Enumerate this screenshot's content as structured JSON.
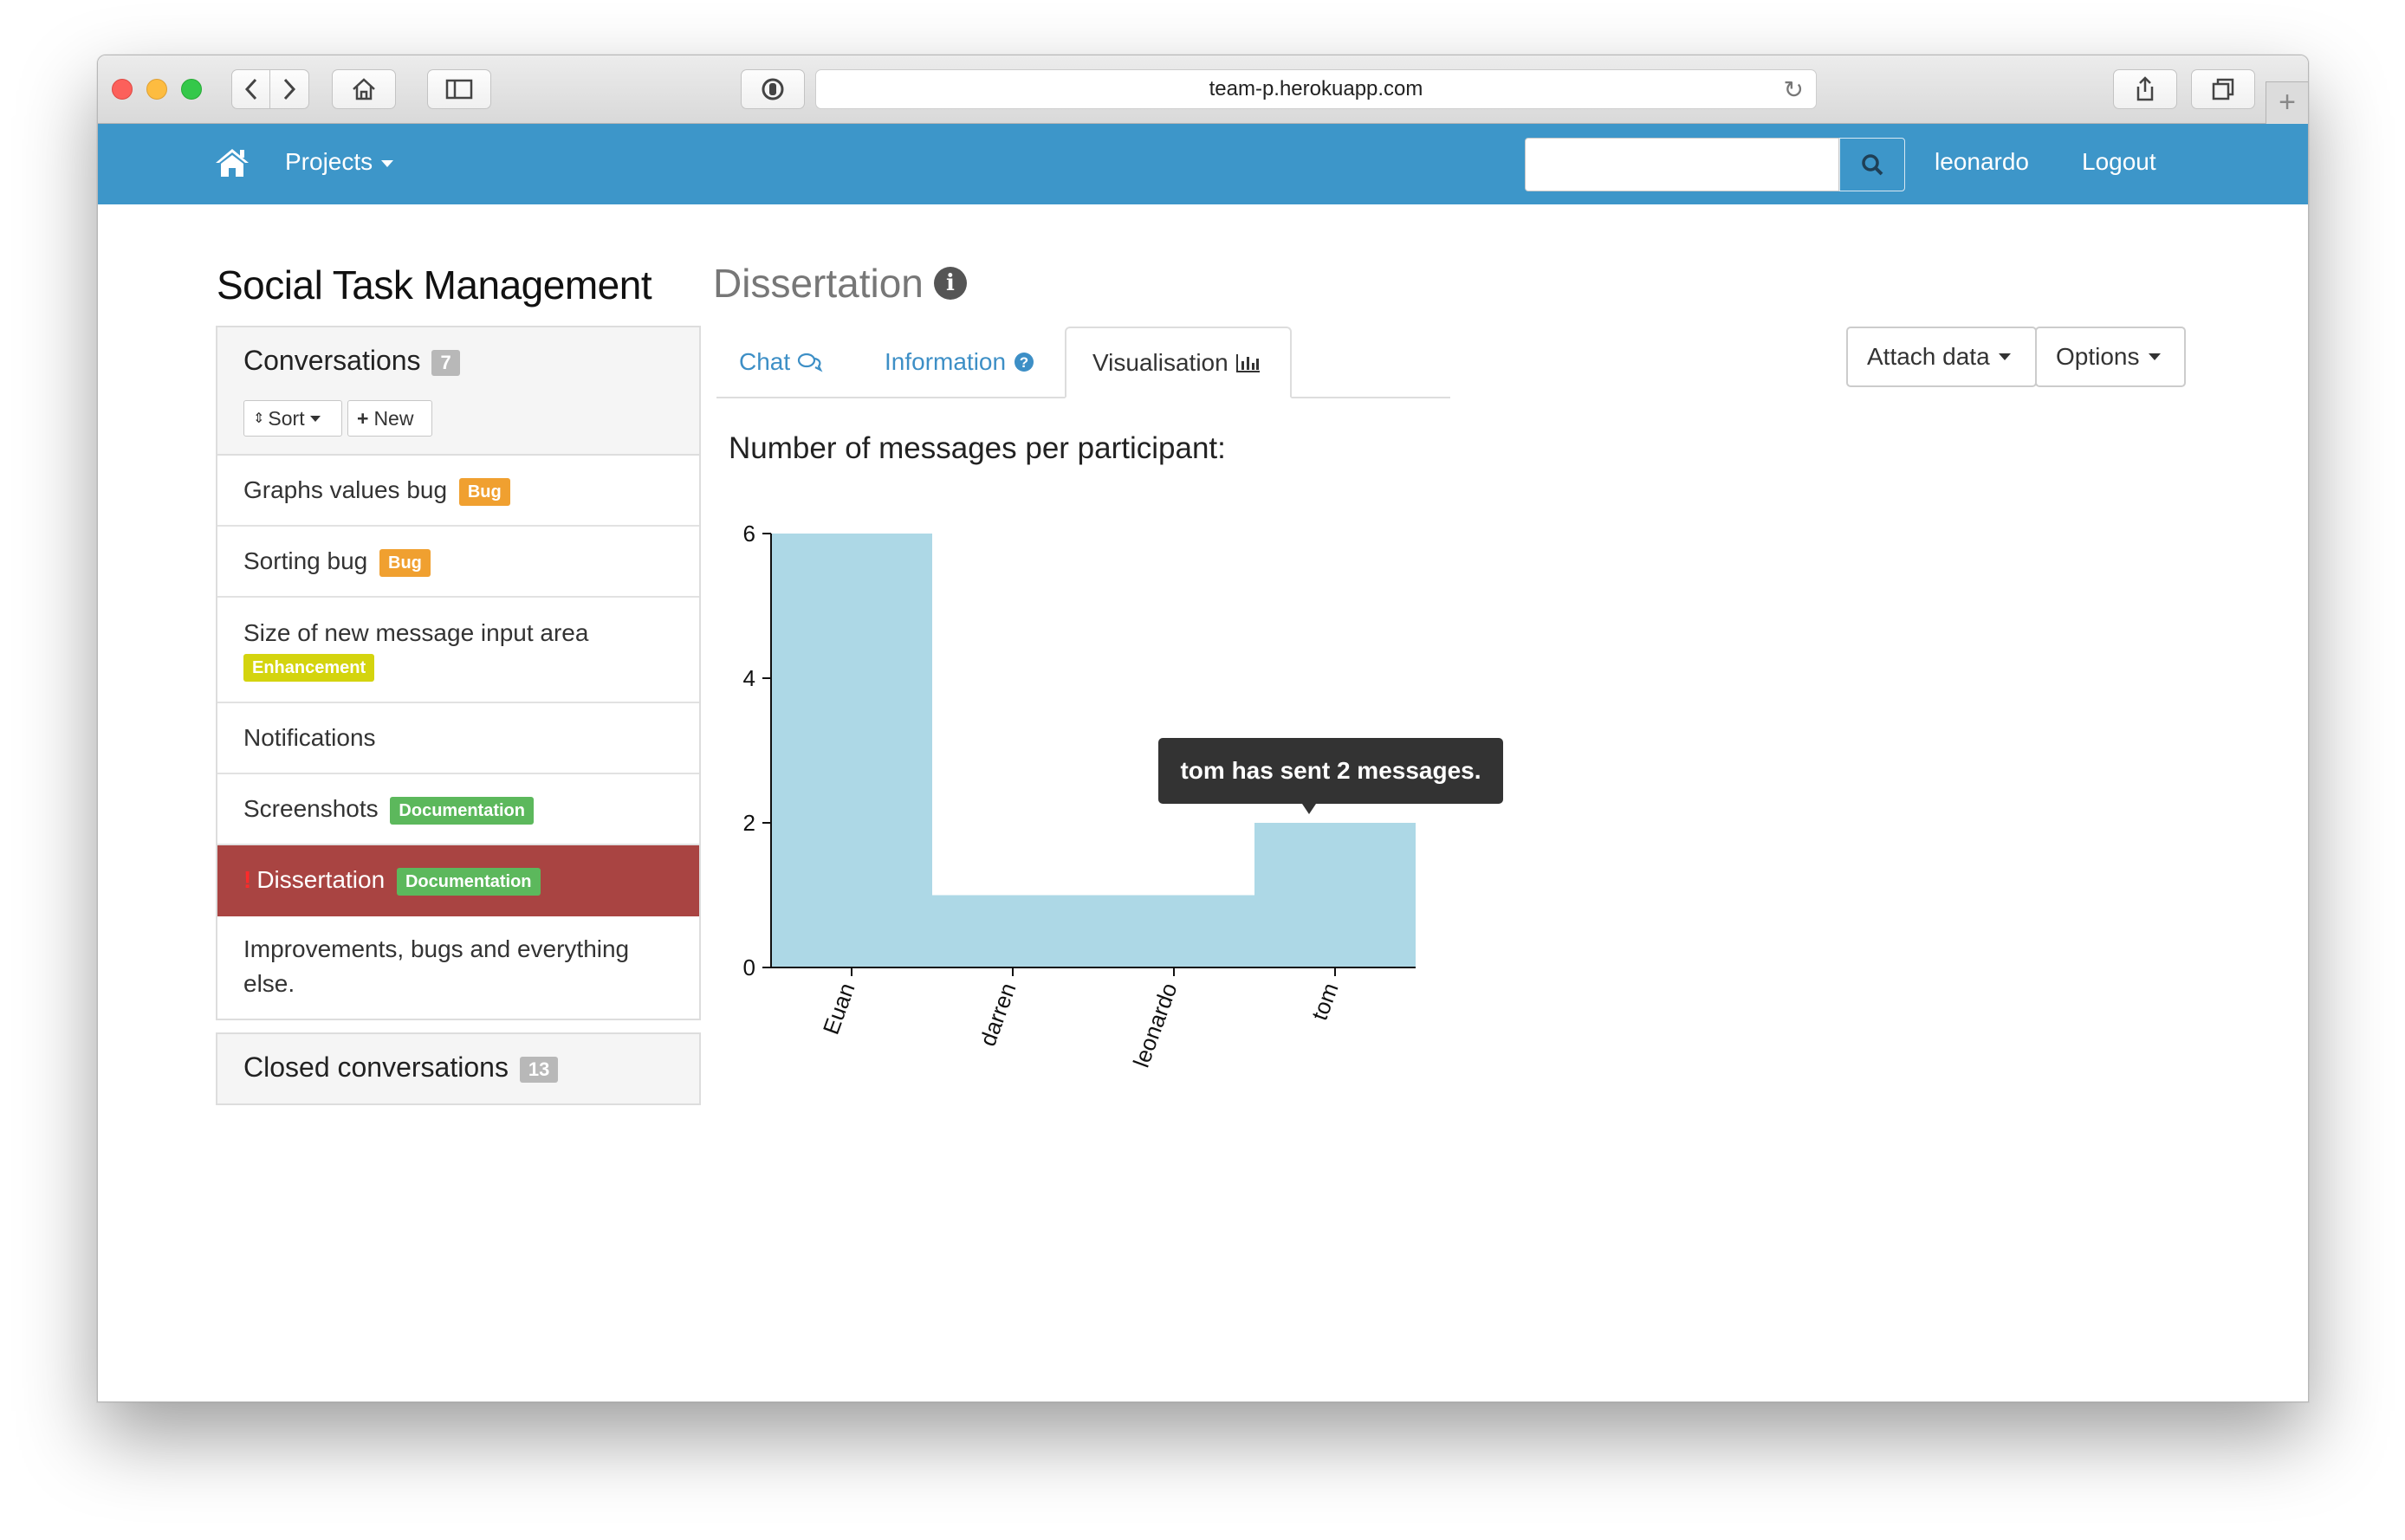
{
  "browser": {
    "url": "team-p.herokuapp.com",
    "colors": {
      "close": "#fc605b",
      "minimize": "#fdbc40",
      "zoom": "#34c84a"
    }
  },
  "navbar": {
    "projects_label": "Projects",
    "search_placeholder": "",
    "user_label": "leonardo",
    "logout_label": "Logout",
    "color": "#3d96c9"
  },
  "header": {
    "title": "Social Task Management",
    "subtitle": "Dissertation"
  },
  "conversations": {
    "title": "Conversations",
    "count": "7",
    "sort_label": "Sort",
    "new_label": "New",
    "items": [
      {
        "label": "Graphs values bug",
        "tag": "Bug",
        "tag_type": "bug"
      },
      {
        "label": "Sorting bug",
        "tag": "Bug",
        "tag_type": "bug"
      },
      {
        "label": "Size of new message input area",
        "tag": "Enhancement",
        "tag_type": "enhancement"
      },
      {
        "label": "Notifications",
        "tag": "",
        "tag_type": ""
      },
      {
        "label": "Screenshots",
        "tag": "Documentation",
        "tag_type": "documentation"
      },
      {
        "label": "Dissertation",
        "tag": "Documentation",
        "tag_type": "documentation",
        "active": true,
        "alert": "!"
      },
      {
        "label": "Improvements, bugs and everything else.",
        "tag": "",
        "tag_type": ""
      }
    ]
  },
  "closed_conversations": {
    "title": "Closed conversations",
    "count": "13"
  },
  "tabs": {
    "chat": "Chat",
    "information": "Information",
    "visualisation": "Visualisation",
    "active": "visualisation"
  },
  "actions": {
    "attach_label": "Attach data",
    "options_label": "Options"
  },
  "chart_title": "Number of messages per participant:",
  "tooltip": "tom has sent 2 messages.",
  "chart_data": {
    "type": "bar",
    "categories": [
      "Euan",
      "darren",
      "leonardo",
      "tom"
    ],
    "values": [
      6,
      1,
      1,
      2
    ],
    "ylim": [
      0,
      6
    ],
    "yticks": [
      0,
      2,
      4,
      6
    ],
    "bar_color": "#add8e6",
    "grid": false
  }
}
